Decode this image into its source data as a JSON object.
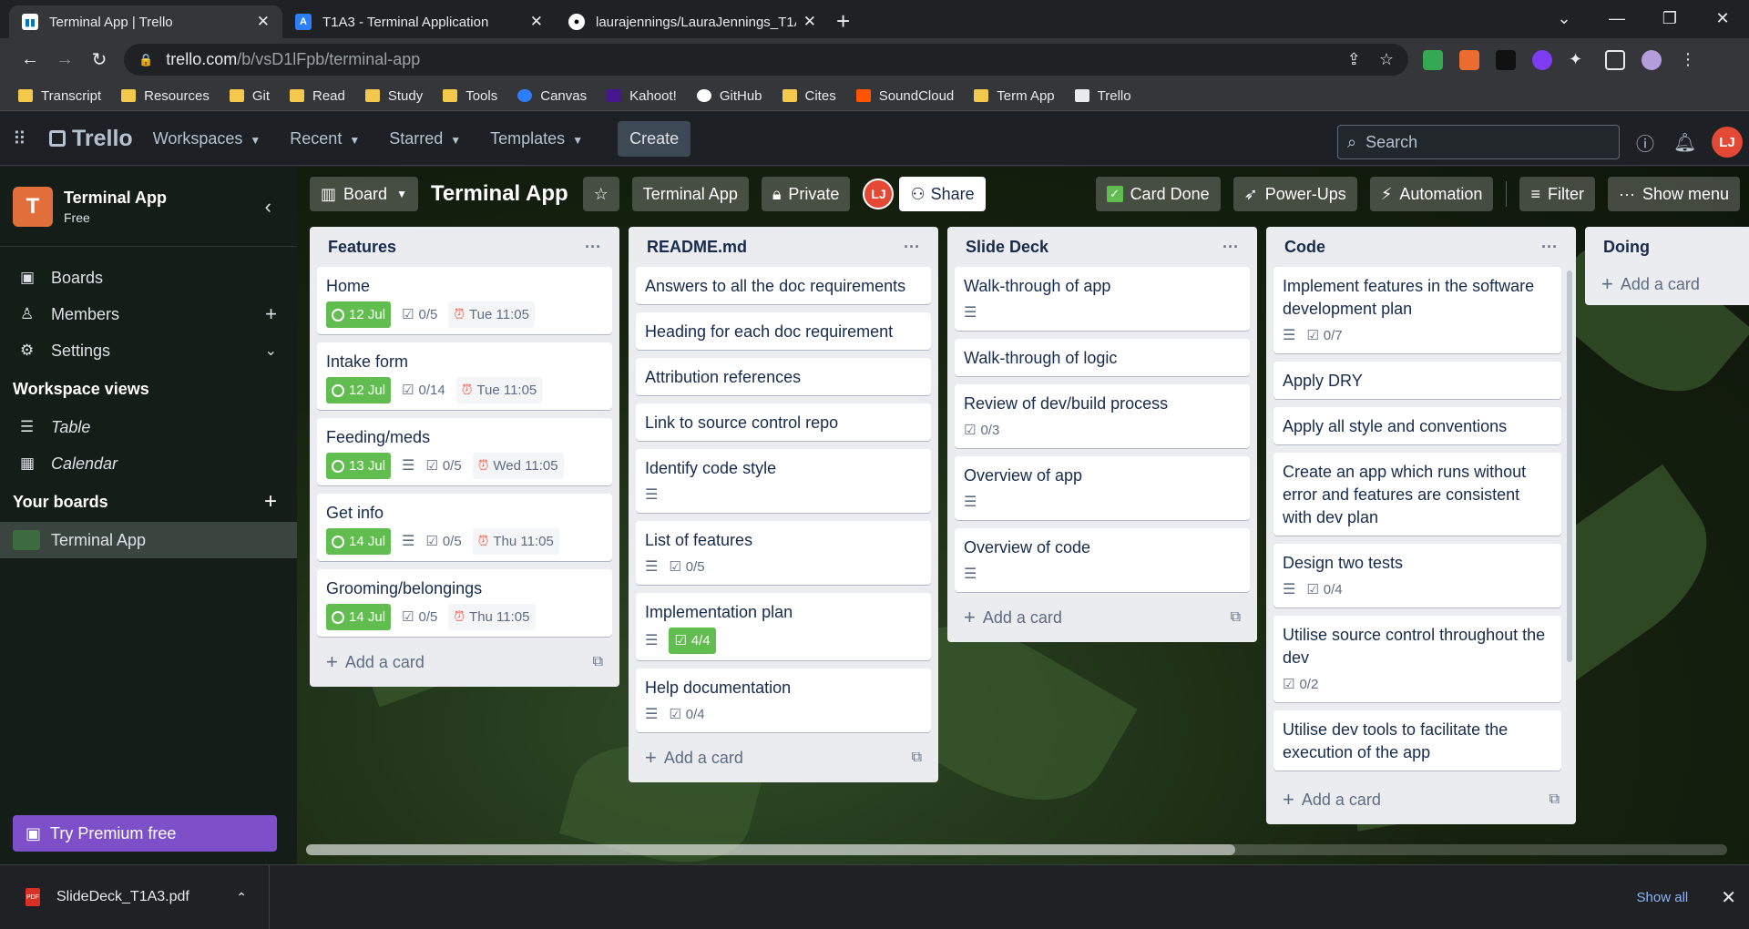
{
  "browser": {
    "tabs": [
      {
        "title": "Terminal App | Trello",
        "active": true
      },
      {
        "title": "T1A3 - Terminal Application",
        "active": false
      },
      {
        "title": "laurajennings/LauraJennings_T1A",
        "active": false
      }
    ],
    "url_host": "trello.com",
    "url_path": "/b/vsD1lFpb/terminal-app",
    "bookmarks": [
      {
        "label": "Transcript",
        "icon": "folder"
      },
      {
        "label": "Resources",
        "icon": "folder"
      },
      {
        "label": "Git",
        "icon": "folder"
      },
      {
        "label": "Read",
        "icon": "folder"
      },
      {
        "label": "Study",
        "icon": "folder"
      },
      {
        "label": "Tools",
        "icon": "folder"
      },
      {
        "label": "Canvas",
        "icon": "canvas"
      },
      {
        "label": "Kahoot!",
        "icon": "kahoot"
      },
      {
        "label": "GitHub",
        "icon": "github"
      },
      {
        "label": "Cites",
        "icon": "folder"
      },
      {
        "label": "SoundCloud",
        "icon": "soundcloud"
      },
      {
        "label": "Term App",
        "icon": "folder"
      },
      {
        "label": "Trello",
        "icon": "trello"
      }
    ]
  },
  "header": {
    "logo": "Trello",
    "menus": [
      "Workspaces",
      "Recent",
      "Starred",
      "Templates"
    ],
    "create": "Create",
    "search_placeholder": "Search",
    "avatar": "LJ"
  },
  "sidebar": {
    "workspace_initial": "T",
    "workspace_name": "Terminal App",
    "workspace_plan": "Free",
    "items": [
      "Boards",
      "Members",
      "Settings"
    ],
    "views_title": "Workspace views",
    "views": [
      "Table",
      "Calendar"
    ],
    "boards_title": "Your boards",
    "boards": [
      "Terminal App"
    ],
    "premium": "Try Premium free"
  },
  "board": {
    "view": "Board",
    "title": "Terminal App",
    "workspace_btn": "Terminal App",
    "visibility": "Private",
    "share": "Share",
    "avatar": "LJ",
    "card_done": "Card Done",
    "powerups": "Power-Ups",
    "automation": "Automation",
    "filter": "Filter",
    "show_menu": "Show menu",
    "add_card": "Add a card"
  },
  "lists": [
    {
      "title": "Features",
      "cards": [
        {
          "title": "Home",
          "due": "12 Jul",
          "checklist": "0/5",
          "start": "Tue 11:05"
        },
        {
          "title": "Intake form",
          "due": "12 Jul",
          "checklist": "0/14",
          "start": "Tue 11:05"
        },
        {
          "title": "Feeding/meds",
          "due": "13 Jul",
          "desc": true,
          "checklist": "0/5",
          "start": "Wed 11:05"
        },
        {
          "title": "Get info",
          "due": "14 Jul",
          "desc": true,
          "checklist": "0/5",
          "start": "Thu 11:05"
        },
        {
          "title": "Grooming/belongings",
          "due": "14 Jul",
          "checklist": "0/5",
          "start": "Thu 11:05"
        }
      ]
    },
    {
      "title": "README.md",
      "cards": [
        {
          "title": "Answers to all the doc requirements"
        },
        {
          "title": "Heading for each doc requirement"
        },
        {
          "title": "Attribution references"
        },
        {
          "title": "Link to source control repo"
        },
        {
          "title": "Identify code style",
          "desc": true
        },
        {
          "title": "List of features",
          "desc": true,
          "checklist": "0/5"
        },
        {
          "title": "Implementation plan",
          "desc": true,
          "checklist": "4/4",
          "complete": true
        },
        {
          "title": "Help documentation",
          "desc": true,
          "checklist": "0/4"
        }
      ]
    },
    {
      "title": "Slide Deck",
      "cards": [
        {
          "title": "Walk-through of app",
          "desc": true
        },
        {
          "title": "Walk-through of logic"
        },
        {
          "title": "Review of dev/build process",
          "checklist": "0/3"
        },
        {
          "title": "Overview of app",
          "desc": true
        },
        {
          "title": "Overview of code",
          "desc": true
        }
      ]
    },
    {
      "title": "Code",
      "cards": [
        {
          "title": "Implement features in the software development plan",
          "desc": true,
          "checklist": "0/7"
        },
        {
          "title": "Apply DRY"
        },
        {
          "title": "Apply all style and conventions"
        },
        {
          "title": "Create an app which runs without error and features are consistent with dev plan"
        },
        {
          "title": "Design two tests",
          "desc": true,
          "checklist": "0/4"
        },
        {
          "title": "Utilise source control throughout the dev",
          "checklist": "0/2"
        },
        {
          "title": "Utilise dev tools to facilitate the execution of the app"
        }
      ]
    },
    {
      "title": "Doing",
      "cards": []
    }
  ],
  "downloads": {
    "file": "SlideDeck_T1A3.pdf",
    "show_all": "Show all"
  }
}
